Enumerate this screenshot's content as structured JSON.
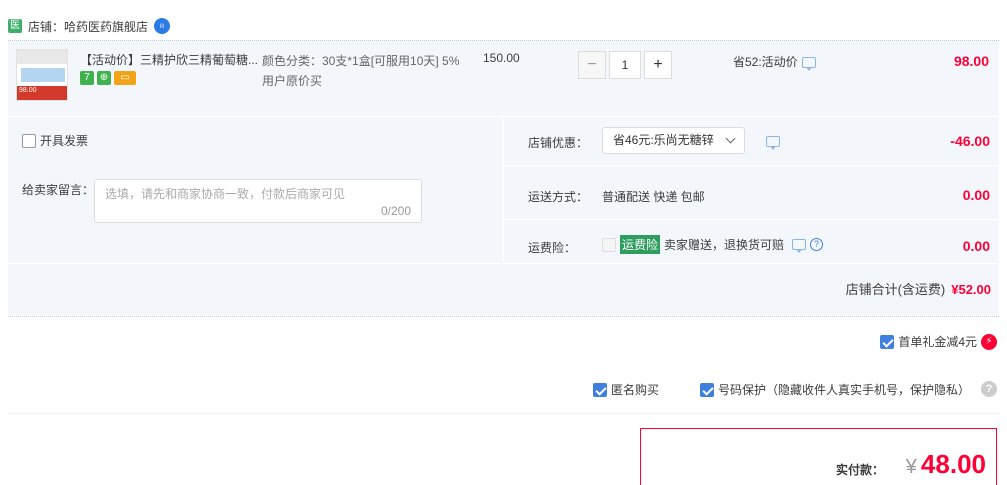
{
  "shop": {
    "icon_text": "医",
    "label": "店铺：哈药医药旗舰店",
    "badge": ""
  },
  "item": {
    "title": "【活动价】三精护欣三精葡萄糖...",
    "sku": "颜色分类：30支*1盒[可服用10天] 5%用户原价买",
    "price": "150.00",
    "quantity": "1",
    "promo": "省52:活动价",
    "total": "98.00",
    "qty_minus": "−",
    "qty_plus": "+",
    "thumb_tag": "98.00"
  },
  "invoice": {
    "label": "开具发票"
  },
  "memo": {
    "label": "给卖家留言：",
    "placeholder": "选填，请先和商家协商一致，付款后商家可见",
    "count": "0/200"
  },
  "discount": {
    "label": "店铺优惠：",
    "selected": "省46元:乐尚无糖锌",
    "value": "-46.00"
  },
  "shipping": {
    "label": "运送方式：",
    "method": "普通配送 快递 包邮",
    "value": "0.00"
  },
  "insurance": {
    "label": "运费险：",
    "badge": "运费险",
    "text": "卖家赠送，退换货可赔",
    "value": "0.00"
  },
  "shop_total": {
    "label": "店铺合计(含运费)",
    "value": "¥52.00"
  },
  "coupon": {
    "label": "首单礼金减4元"
  },
  "anonymous": {
    "label": "匿名购买"
  },
  "privacy": {
    "label": "号码保护（隐藏收件人真实手机号，保护隐私）"
  },
  "payment": {
    "label": "实付款：",
    "currency": "¥",
    "amount": "48.00"
  },
  "colors": {
    "accent_red": "#ff0036",
    "checkbox_blue": "#3f7fe0",
    "row_bg": "#f3f7fc"
  },
  "icons": [
    "shop-icon",
    "chat-icon",
    "help-icon",
    "bolt-icon",
    "question-icon",
    "chevron-down-icon"
  ]
}
